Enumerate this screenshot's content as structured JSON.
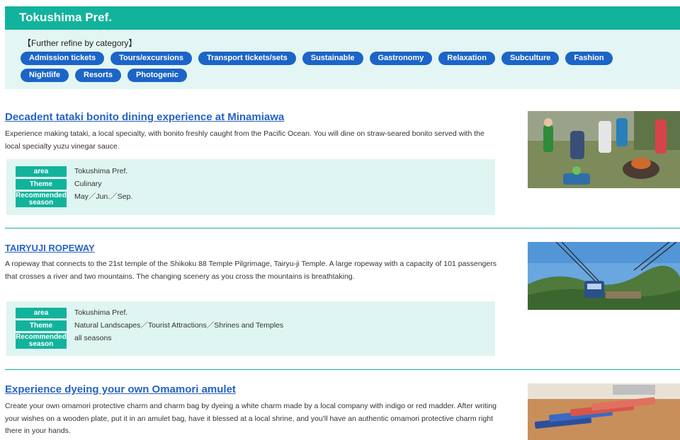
{
  "prefecture": {
    "title": "Tokushima Pref."
  },
  "refine": {
    "title": "【Further refine by category】",
    "categories": [
      "Admission tickets",
      "Tours/excursions",
      "Transport tickets/sets",
      "Sustainable",
      "Gastronomy",
      "Relaxation",
      "Subculture",
      "Fashion",
      "Nightlife",
      "Resorts",
      "Photogenic"
    ]
  },
  "labels": {
    "area": "area",
    "theme": "Theme",
    "season": "Recommended season"
  },
  "items": [
    {
      "title": "Decadent tataki bonito dining experience at Minamiawa",
      "description": "Experience making tataki, a local specialty, with bonito freshly caught from the Pacific Ocean. You will dine on straw-seared bonito served with the local specialty yuzu vinegar sauce.",
      "area": "Tokushima Pref.",
      "theme": "Culinary",
      "season": "May／Jun.／Sep."
    },
    {
      "title": "TAIRYUJI ROPEWAY",
      "description": "A ropeway that connects to the 21st temple of the Shikoku 88 Temple Pilgrimage, Tairyu-ji Temple. A large ropeway with a capacity of 101 passengers that crosses a river and two mountains. The changing scenery as you cross the mountains is breathtaking.",
      "area": "Tokushima Pref.",
      "theme": "Natural Landscapes／Tourist Attractions／Shrines and Temples",
      "season": "all seasons"
    },
    {
      "title": "Experience dyeing your own Omamori amulet",
      "description": "Create your own omamori protective charm and charm bag by dyeing a white charm made by a local company with indigo or red madder. After writing your wishes on a wooden plate, put it in an amulet bag, have it blessed at a local shrine, and you'll have an authentic omamori protective charm right there in your hands."
    }
  ]
}
